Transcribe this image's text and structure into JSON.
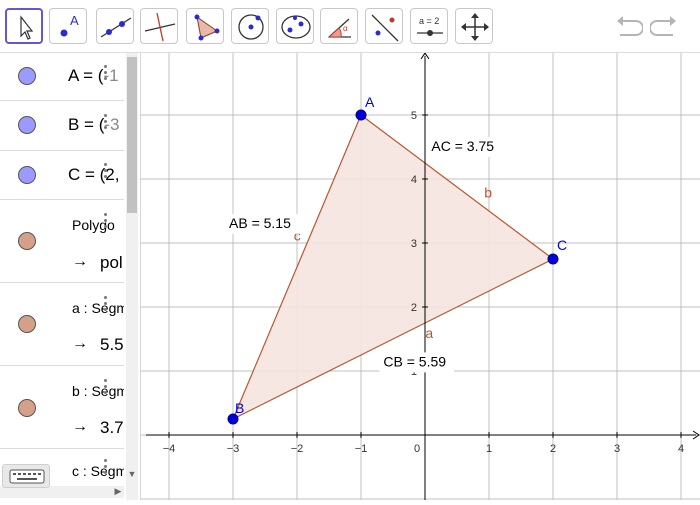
{
  "toolbar": {
    "tools": [
      {
        "name": "move-tool-icon"
      },
      {
        "name": "point-tool-icon",
        "point_label": "A"
      },
      {
        "name": "line-tool-icon"
      },
      {
        "name": "perpendicular-line-tool-icon"
      },
      {
        "name": "polygon-tool-icon"
      },
      {
        "name": "circle-center-point-tool-icon"
      },
      {
        "name": "conic-tool-icon"
      },
      {
        "name": "angle-tool-icon"
      },
      {
        "name": "reflect-tool-icon"
      },
      {
        "name": "slider-tool-icon",
        "slider_label": "a = 2"
      },
      {
        "name": "move-graphics-view-icon"
      }
    ],
    "undo_icon": "undo-icon",
    "redo_icon": "redo-icon"
  },
  "algebra": {
    "items": [
      {
        "label": "A = (",
        "cut": "-1",
        "color": "#9b9bff"
      },
      {
        "label": "B = (",
        "cut": "-3",
        "color": "#9b9bff"
      },
      {
        "label": "C = (2,",
        "color": "#9b9bff"
      },
      {
        "label": "Polygo",
        "output": "pol",
        "color": "#d5a08a"
      },
      {
        "label": "a : Segm",
        "output": "5.5",
        "color": "#d5a08a"
      },
      {
        "label": "b : Segm",
        "output": "3.7",
        "color": "#d5a08a"
      },
      {
        "label": "c : Segm",
        "color": "#d5a08a"
      }
    ],
    "arrow": "→"
  },
  "graphics": {
    "axis_color": "#000000",
    "grid_color": "#c0c0c0",
    "triangle_fill": "#f5e4df",
    "triangle_stroke": "#b5572f",
    "point_color": "#0000dd",
    "x_ticks": [
      "−4",
      "−3",
      "−2",
      "−1",
      "0",
      "1",
      "2",
      "3",
      "4"
    ],
    "y_ticks": [
      "1",
      "2",
      "3",
      "4",
      "5"
    ],
    "points": [
      {
        "label": "A",
        "x": -1,
        "y": 5
      },
      {
        "label": "B",
        "x": -3,
        "y": 0.25
      },
      {
        "label": "C",
        "x": 2,
        "y": 2.75
      }
    ],
    "segment_names": {
      "a": "a",
      "b": "b",
      "c": "c"
    },
    "captions": {
      "ab": "AB = 5.15",
      "ac": "AC = 3.75",
      "cb": "CB = 5.59"
    }
  }
}
